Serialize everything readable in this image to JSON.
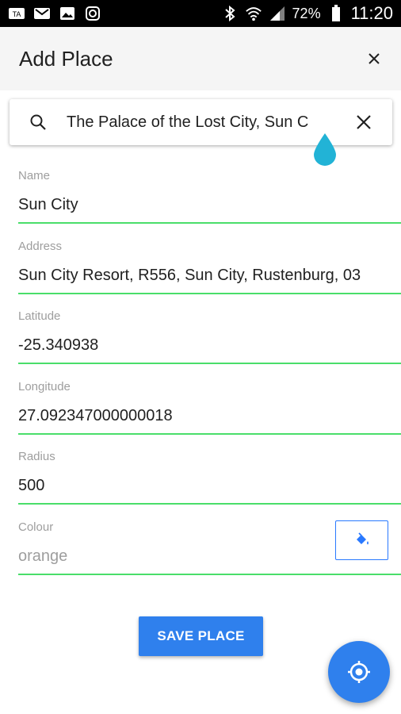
{
  "status_bar": {
    "battery": "72%",
    "time": "11:20"
  },
  "app_bar": {
    "title": "Add Place"
  },
  "search": {
    "value": "The Palace of the Lost City, Sun C"
  },
  "form": {
    "name": {
      "label": "Name",
      "value": "Sun City"
    },
    "address": {
      "label": "Address",
      "value": "Sun City Resort, R556, Sun City, Rustenburg, 03"
    },
    "latitude": {
      "label": "Latitude",
      "value": "-25.340938"
    },
    "longitude": {
      "label": "Longitude",
      "value": "27.092347000000018"
    },
    "radius": {
      "label": "Radius",
      "value": "500"
    },
    "colour": {
      "label": "Colour",
      "placeholder": "orange"
    }
  },
  "actions": {
    "save_label": "SAVE PLACE"
  },
  "colors": {
    "accent": "#2f80ed",
    "underline": "#4ade6a",
    "handle": "#22b3d6"
  }
}
